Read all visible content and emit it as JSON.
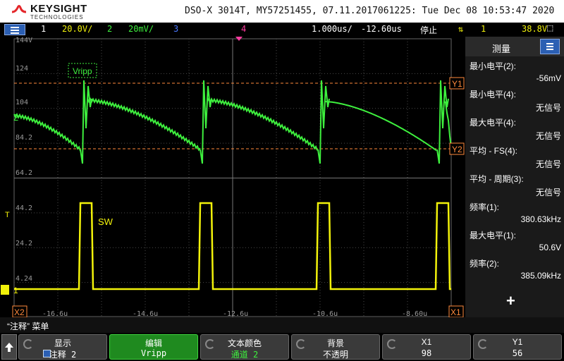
{
  "header": {
    "logo_text": "KEYSIGHT",
    "logo_sub": "TECHNOLOGIES",
    "scope_info": "DSO-X 3014T, MY57251455, 07.11.2017061225: Tue Dec 08 10:53:47 2020"
  },
  "status": {
    "ch1_num": "1",
    "ch1_scale": "20.0V/",
    "ch2_num": "2",
    "ch2_scale": "20mV/",
    "ch3_num": "3",
    "ch4_num": "4",
    "timebase": "1.000us/",
    "delay": "-12.60us",
    "run_state": "停止",
    "trigger_icon": "trigger-edge-icon",
    "trigger_ch": "1",
    "trigger_level": "38.8V"
  },
  "plot": {
    "y_ticks": [
      "144V",
      "124",
      "104",
      "84.2",
      "64.2",
      "44.2",
      "24.2",
      "4.24"
    ],
    "x_ticks": [
      "-16.6u",
      "-14.6u",
      "-12.6u",
      "-10.6u",
      "-8.60u"
    ],
    "annotation_vripp": "Vripp",
    "annotation_sw": "SW",
    "cursor_y1": "Y1",
    "cursor_y2": "Y2",
    "cursor_x1": "X1",
    "cursor_x2": "X2",
    "ch1_marker": "1",
    "ch2_marker": "2",
    "trig_marker": "T"
  },
  "colors": {
    "ch1": "#f2f20a",
    "ch2": "#3ef03e",
    "ch3": "#4a78ff",
    "ch4": "#ff3ca0",
    "cursor": "#ff8a3c",
    "grid": "#4a4a4a"
  },
  "panel": {
    "title": "测量",
    "measurements": [
      {
        "label": "最小电平(2):",
        "value": "-56mV"
      },
      {
        "label": "最小电平(4):",
        "value": "无信号"
      },
      {
        "label": "最大电平(4):",
        "value": "无信号"
      },
      {
        "label": "平均 - FS(4):",
        "value": "无信号"
      },
      {
        "label": "平均 - 周期(3):",
        "value": "无信号"
      },
      {
        "label": "频率(1):",
        "value": "380.63kHz"
      },
      {
        "label": "最大电平(1):",
        "value": "50.6V"
      },
      {
        "label": "频率(2):",
        "value": "385.09kHz"
      }
    ],
    "add_symbol": "+"
  },
  "footer": {
    "menu_title": "“注释” 菜单",
    "keys": [
      {
        "title": "显示",
        "value": "注释 2"
      },
      {
        "title": "编辑",
        "value": "Vripp"
      },
      {
        "title": "文本颜色",
        "value": "通道 2"
      },
      {
        "title": "背景",
        "value": "不透明"
      },
      {
        "title": "X1",
        "value": "98"
      },
      {
        "title": "Y1",
        "value": "56"
      }
    ]
  }
}
